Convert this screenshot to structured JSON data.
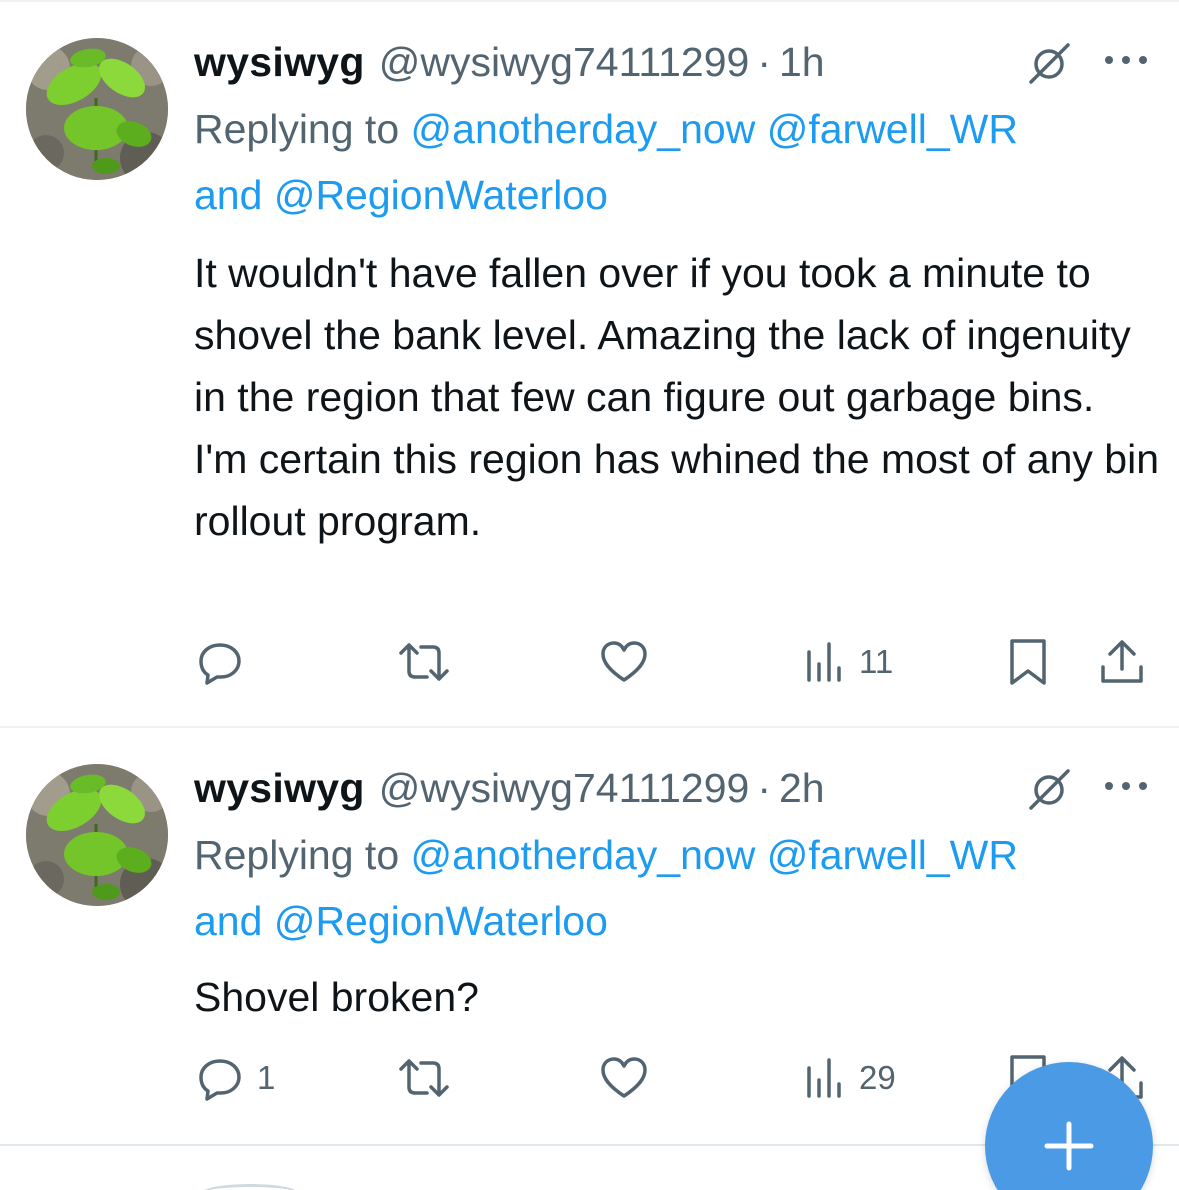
{
  "tweets": [
    {
      "name": "wysiwyg",
      "handle": "@wysiwyg74111299",
      "separator": "·",
      "time": "1h",
      "reply_prefix": "Replying to",
      "mentions": [
        "@anotherday_now",
        "@farwell_WR",
        "@RegionWaterloo"
      ],
      "reply_joiner": "and",
      "text": "It wouldn't have fallen over if you took a minute to shovel the bank level. Amazing the lack of ingenuity in the region that few can figure out garbage bins. I'm certain this region has whined the most of any bin rollout program.",
      "counts": {
        "replies": "",
        "retweets": "",
        "likes": "",
        "views": "11"
      }
    },
    {
      "name": "wysiwyg",
      "handle": "@wysiwyg74111299",
      "separator": "·",
      "time": "2h",
      "reply_prefix": "Replying to",
      "mentions": [
        "@anotherday_now",
        "@farwell_WR",
        "@RegionWaterloo"
      ],
      "reply_joiner": "and",
      "text": "Shovel broken?",
      "counts": {
        "replies": "1",
        "retweets": "",
        "likes": "",
        "views": "29"
      }
    }
  ],
  "icons": {
    "muted": "muted-icon",
    "more": "more-icon",
    "reply": "reply-icon",
    "retweet": "retweet-icon",
    "like": "heart-icon",
    "views": "views-icon",
    "bookmark": "bookmark-icon",
    "share": "share-icon",
    "compose": "plus-icon"
  },
  "colors": {
    "mention": "#1d9bf0",
    "secondary_text": "#536471",
    "primary_text": "#0f1419",
    "fab": "#4a9ae6",
    "divider": "#eff3f4"
  }
}
